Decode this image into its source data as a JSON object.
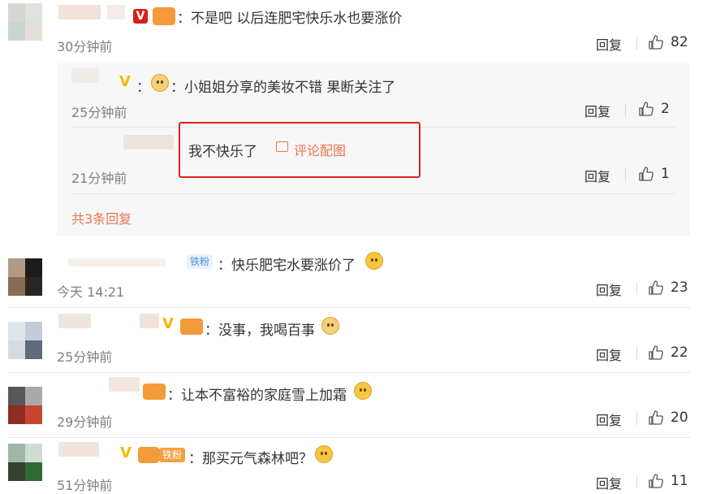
{
  "comments": [
    {
      "text": "：不是吧 以后连肥宅快乐水也要涨价",
      "time": "30分钟前",
      "reply_label": "回复",
      "likes": "82",
      "replies": [
        {
          "text": "：小姐姐分享的美妆不错 果断关注了",
          "time": "25分钟前",
          "reply_label": "回复",
          "likes": "2"
        },
        {
          "text": "我不快乐了",
          "image_link": "评论配图",
          "time": "21分钟前",
          "reply_label": "回复",
          "likes": "1"
        }
      ],
      "more_replies": "共3条回复"
    },
    {
      "badge": "铁粉",
      "text": "：快乐肥宅水要涨价了",
      "time": "今天 14:21",
      "reply_label": "回复",
      "likes": "23"
    },
    {
      "text": "：没事，我喝百事",
      "time": "25分钟前",
      "reply_label": "回复",
      "likes": "22"
    },
    {
      "text": "：让本不富裕的家庭雪上加霜",
      "time": "29分钟前",
      "reply_label": "回复",
      "likes": "20"
    },
    {
      "badge": "铁粉",
      "text": "：那买元气森林吧？",
      "time": "51分钟前",
      "reply_label": "回复",
      "likes": "11"
    }
  ],
  "verified_letter": "V",
  "colors": {
    "highlight_border": "#e02020",
    "link_orange": "#eb7350",
    "v_red": "#d6211a",
    "v_yellow": "#f2b705",
    "reply_bg": "#f7f7f7"
  }
}
